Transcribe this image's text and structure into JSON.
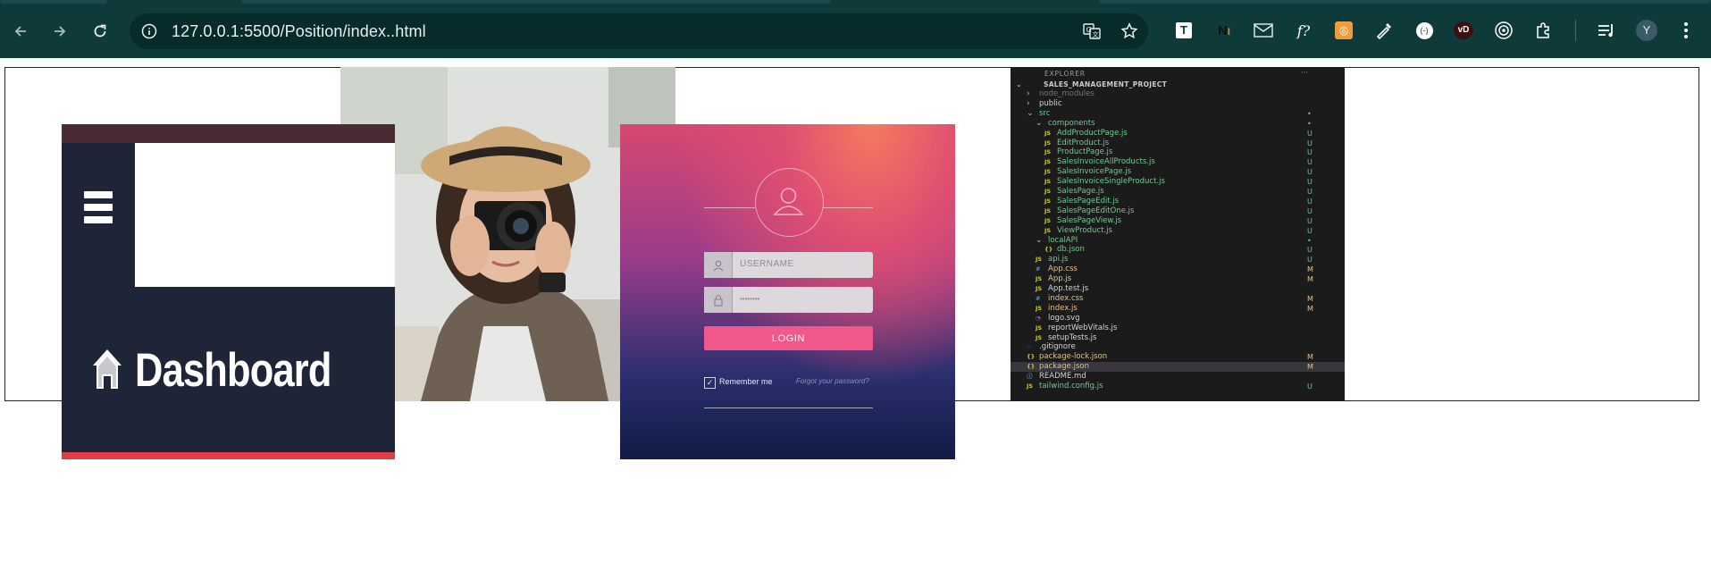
{
  "browser": {
    "url": "127.0.0.1:5500/Position/index..html",
    "profile_initial": "Y",
    "extensions": [
      "translate-icon",
      "bookmark-star-icon",
      "extension-t-icon",
      "extension-n-icon",
      "extension-mail-icon",
      "extension-fx-icon",
      "extension-orange-icon",
      "eyedropper-icon",
      "extension-circle-icon",
      "extension-vd-icon",
      "extension-target-icon",
      "extensions-puzzle-icon",
      "media-queue-icon"
    ],
    "colors": {
      "frame": "#0e3a3a",
      "omnibox": "#072a2a",
      "text": "#e8f0f0"
    }
  },
  "dashboard_image": {
    "title": "Dashboard",
    "colors": {
      "bg": "#1e2537",
      "accent": "#e23c47"
    }
  },
  "login_image": {
    "username_placeholder": "USERNAME",
    "password_placeholder": "••••••••",
    "login_label": "LOGIN",
    "remember_label": "Remember me",
    "forgot_label": "Forgot your password?",
    "accent": "#f0588b"
  },
  "explorer_image": {
    "header": "EXPLORER",
    "project": "SALES_MANAGEMENT_PROJECT",
    "items": [
      {
        "label": "node_modules",
        "indent": 1,
        "kind": "folder-closed",
        "color": "#6e7a6e",
        "badge": ""
      },
      {
        "label": "public",
        "indent": 1,
        "kind": "folder-closed",
        "color": "#d4d4d4",
        "badge": ""
      },
      {
        "label": "src",
        "indent": 1,
        "kind": "folder-open",
        "color": "#73c991",
        "badge": "•"
      },
      {
        "label": "components",
        "indent": 2,
        "kind": "folder-open",
        "color": "#73c991",
        "badge": "•"
      },
      {
        "label": "AddProductPage.js",
        "indent": 3,
        "kind": "js",
        "color": "#73c991",
        "badge": "U"
      },
      {
        "label": "EditProduct.js",
        "indent": 3,
        "kind": "js",
        "color": "#73c991",
        "badge": "U"
      },
      {
        "label": "ProductPage.js",
        "indent": 3,
        "kind": "js",
        "color": "#73c991",
        "badge": "U"
      },
      {
        "label": "SalesInvoiceAllProducts.js",
        "indent": 3,
        "kind": "js",
        "color": "#73c991",
        "badge": "U"
      },
      {
        "label": "SalesInvoicePage.js",
        "indent": 3,
        "kind": "js",
        "color": "#73c991",
        "badge": "U"
      },
      {
        "label": "SalesInvoiceSingleProduct.js",
        "indent": 3,
        "kind": "js",
        "color": "#73c991",
        "badge": "U"
      },
      {
        "label": "SalesPage.js",
        "indent": 3,
        "kind": "js",
        "color": "#73c991",
        "badge": "U"
      },
      {
        "label": "SalesPageEdit.js",
        "indent": 3,
        "kind": "js",
        "color": "#73c991",
        "badge": "U"
      },
      {
        "label": "SalesPageEditOne.js",
        "indent": 3,
        "kind": "js",
        "color": "#73c991",
        "badge": "U"
      },
      {
        "label": "SalesPageView.js",
        "indent": 3,
        "kind": "js",
        "color": "#73c991",
        "badge": "U"
      },
      {
        "label": "ViewProduct.js",
        "indent": 3,
        "kind": "js",
        "color": "#73c991",
        "badge": "U"
      },
      {
        "label": "localAPI",
        "indent": 2,
        "kind": "folder-open",
        "color": "#73c991",
        "badge": "•"
      },
      {
        "label": "db.json",
        "indent": 3,
        "kind": "json",
        "color": "#73c991",
        "badge": "U"
      },
      {
        "label": "api.js",
        "indent": 2,
        "kind": "js",
        "color": "#73c991",
        "badge": "U"
      },
      {
        "label": "App.css",
        "indent": 2,
        "kind": "css",
        "color": "#e2c08d",
        "badge": "M"
      },
      {
        "label": "App.js",
        "indent": 2,
        "kind": "js",
        "color": "#e2c08d",
        "badge": "M"
      },
      {
        "label": "App.test.js",
        "indent": 2,
        "kind": "js",
        "color": "#d4d4d4",
        "badge": ""
      },
      {
        "label": "index.css",
        "indent": 2,
        "kind": "css",
        "color": "#e2c08d",
        "badge": "M"
      },
      {
        "label": "index.js",
        "indent": 2,
        "kind": "js",
        "color": "#e2c08d",
        "badge": "M"
      },
      {
        "label": "logo.svg",
        "indent": 2,
        "kind": "svg",
        "color": "#d4d4d4",
        "badge": ""
      },
      {
        "label": "reportWebVitals.js",
        "indent": 2,
        "kind": "js",
        "color": "#d4d4d4",
        "badge": ""
      },
      {
        "label": "setupTests.js",
        "indent": 2,
        "kind": "js",
        "color": "#d4d4d4",
        "badge": ""
      },
      {
        "label": ".gitignore",
        "indent": 1,
        "kind": "git",
        "color": "#d4d4d4",
        "badge": ""
      },
      {
        "label": "package-lock.json",
        "indent": 1,
        "kind": "json",
        "color": "#e2c08d",
        "badge": "M"
      },
      {
        "label": "package.json",
        "indent": 1,
        "kind": "json",
        "color": "#e2c08d",
        "badge": "M",
        "selected": true
      },
      {
        "label": "README.md",
        "indent": 1,
        "kind": "info",
        "color": "#d4d4d4",
        "badge": ""
      },
      {
        "label": "tailwind.config.js",
        "indent": 1,
        "kind": "js",
        "color": "#73c991",
        "badge": "U"
      }
    ]
  }
}
